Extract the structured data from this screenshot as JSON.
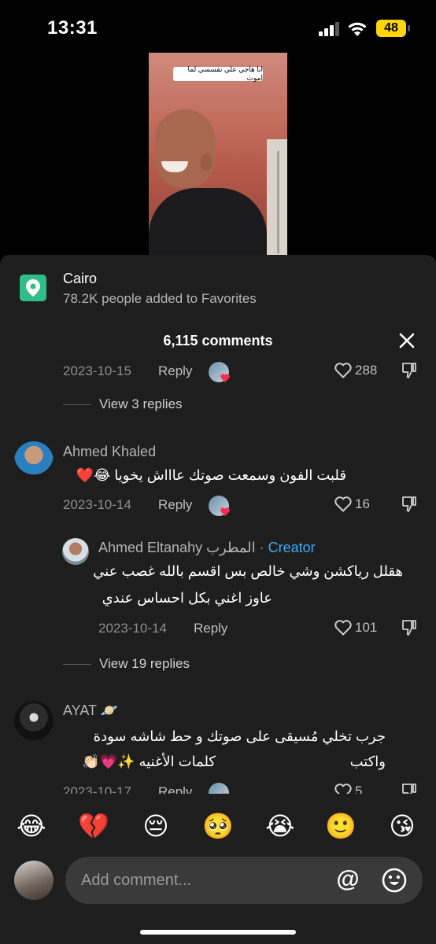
{
  "status_bar": {
    "time": "13:31",
    "battery": "48"
  },
  "video": {
    "caption": "انا هاجي علي نفسسي لما اموت"
  },
  "location": {
    "title": "Cairo",
    "subtitle": "78.2K people added to Favorites"
  },
  "comments_header": {
    "count_label": "6,115 comments"
  },
  "comments": {
    "top_row": {
      "date": "2023-10-15",
      "reply": "Reply",
      "likes": "288",
      "view_replies": "View 3 replies"
    },
    "c1": {
      "user": "Ahmed Khaled",
      "text": "قلبت الفون وسمعت صوتك عاااش يخويا 😂❤️",
      "date": "2023-10-14",
      "reply": "Reply",
      "likes": "16"
    },
    "r1": {
      "user": "Ahmed Eltanahy المطرب",
      "creator_label": " · Creator",
      "line1": "هقلل رياكشن وشي خالص بس اقسم بالله غصب عني",
      "line2": "عاوز اغني بكل احساس عندي",
      "date": "2023-10-14",
      "reply": "Reply",
      "likes": "101"
    },
    "view_more": "View 19 replies",
    "c2": {
      "user": "AYAT 🪐",
      "line1": "جرب تخلي مُسيقى على صوتك و حط شاشه سودة واكتب",
      "line2": "كلمات الأغنيه ✨💗👏🏻",
      "date": "2023-10-17",
      "reply": "Reply",
      "likes": "5"
    }
  },
  "emoji_bar": [
    "😂",
    "💔",
    "😔",
    "🥺",
    "😭",
    "🙂",
    "😘"
  ],
  "input": {
    "placeholder": "Add comment...",
    "at_label": "@"
  },
  "colors": {
    "sheet_bg": "#1e1e1e",
    "accent_green": "#2fbe88",
    "creator_blue": "#3fa9f5",
    "like_heart": "#fe2c55"
  }
}
